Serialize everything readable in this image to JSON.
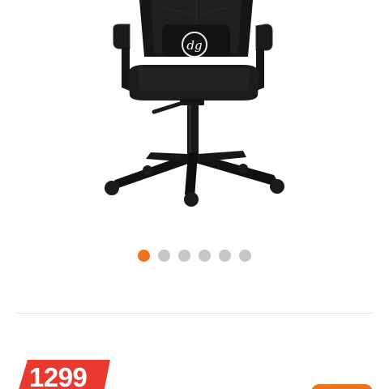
{
  "product": {
    "logo_text": "dg",
    "image_dots": {
      "count": 6,
      "active_index": 0
    }
  },
  "price": {
    "value": "1299"
  },
  "colors": {
    "accent": "#f0731e",
    "price_red": "#ea3a2f",
    "dot_inactive": "#c6c6c6",
    "chair": "#1c1c1c"
  }
}
